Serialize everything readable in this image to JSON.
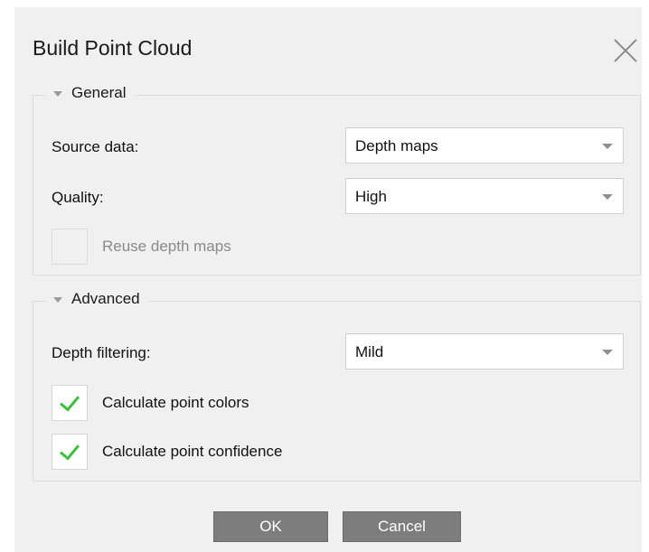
{
  "dialog": {
    "title": "Build Point Cloud"
  },
  "general": {
    "header": "General",
    "source_data": {
      "label": "Source data:",
      "value": "Depth maps"
    },
    "quality": {
      "label": "Quality:",
      "value": "High"
    },
    "reuse_depth_maps": {
      "label": "Reuse depth maps",
      "checked": false,
      "enabled": false
    }
  },
  "advanced": {
    "header": "Advanced",
    "depth_filtering": {
      "label": "Depth filtering:",
      "value": "Mild"
    },
    "calculate_point_colors": {
      "label": "Calculate point colors",
      "checked": true
    },
    "calculate_point_confidence": {
      "label": "Calculate point confidence",
      "checked": true
    }
  },
  "buttons": {
    "ok": "OK",
    "cancel": "Cancel"
  },
  "colors": {
    "button_bg": "#7d7d7d",
    "check_accent": "#3cc03c",
    "dialog_bg": "#f0f0f0"
  }
}
